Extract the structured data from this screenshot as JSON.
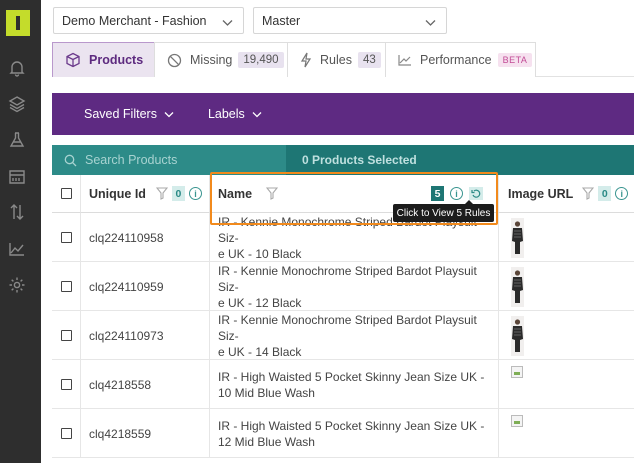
{
  "selects": {
    "merchant": "Demo Merchant - Fashion",
    "catalog": "Master"
  },
  "tabs": [
    {
      "label": "Products",
      "icon": "cube-icon",
      "active": true
    },
    {
      "label": "Missing",
      "icon": "prohibited-icon",
      "count": "19,490"
    },
    {
      "label": "Rules",
      "icon": "lightning-icon",
      "count": "43"
    },
    {
      "label": "Performance",
      "icon": "line-chart-icon",
      "badge": "BETA"
    }
  ],
  "filterbar": {
    "saved_filters": "Saved Filters",
    "labels": "Labels"
  },
  "search": {
    "placeholder": "Search Products",
    "selected": "0 Products Selected"
  },
  "columns": {
    "unique_id": {
      "label": "Unique Id",
      "filter_count": "0"
    },
    "name": {
      "label": "Name",
      "rules_count": "5"
    },
    "image_url": {
      "label": "Image URL",
      "filter_count": "0"
    }
  },
  "tooltip": "Click to View 5 Rules",
  "rows": [
    {
      "id": "clq224110958",
      "name_line1": "IR - Kennie Monochrome Striped Bardot Playsuit Siz-",
      "name_line2": "e UK - 10 Black",
      "image": "model-photo"
    },
    {
      "id": "clq224110959",
      "name_line1": "IR - Kennie Monochrome Striped Bardot Playsuit Siz-",
      "name_line2": "e UK - 12 Black",
      "image": "model-photo"
    },
    {
      "id": "clq224110973",
      "name_line1": "IR - Kennie Monochrome Striped Bardot Playsuit Siz-",
      "name_line2": "e UK - 14 Black",
      "image": "model-photo"
    },
    {
      "id": "clq4218558",
      "name_line1": "IR - High Waisted 5 Pocket Skinny Jean Size UK -",
      "name_line2": "10 Mid Blue Wash",
      "image": "broken-image"
    },
    {
      "id": "clq4218559",
      "name_line1": "IR - High Waisted 5 Pocket Skinny Jean Size UK -",
      "name_line2": "12 Mid Blue Wash",
      "image": "broken-image"
    }
  ],
  "colors": {
    "rail": "#2e2e2e",
    "logo": "#c4dc2b",
    "purple": "#5e2a82",
    "teal": "#1e7674",
    "highlight": "#f28a1c"
  }
}
